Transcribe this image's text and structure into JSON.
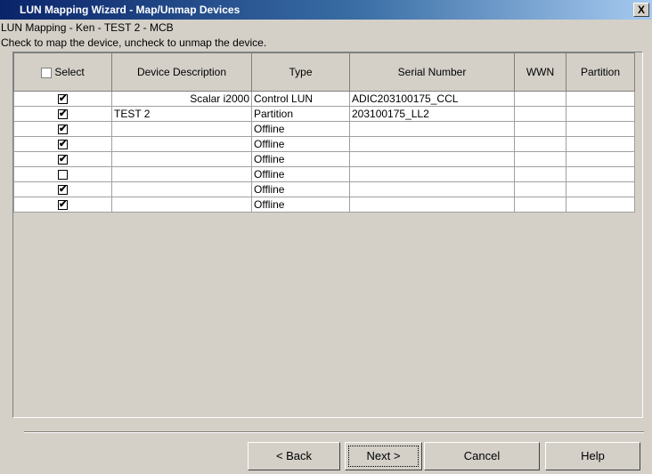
{
  "window": {
    "title": "LUN Mapping Wizard - Map/Unmap Devices",
    "close_label": "X"
  },
  "info": {
    "line1": "LUN Mapping - Ken - TEST 2 - MCB",
    "line2": "Check to map the device, uncheck to unmap the device."
  },
  "table": {
    "headers": [
      "Select",
      "Device Description",
      "Type",
      "Serial Number",
      "WWN",
      "Partition"
    ],
    "rows": [
      {
        "checked": true,
        "description": "Scalar i2000",
        "type": "Control LUN",
        "serial": "ADIC203100175_CCL",
        "wwn": "",
        "partition": ""
      },
      {
        "checked": true,
        "description": "TEST 2",
        "type": "Partition",
        "serial": "203100175_LL2",
        "wwn": "",
        "partition": ""
      },
      {
        "checked": true,
        "description": "",
        "type": "Offline",
        "serial": "",
        "wwn": "",
        "partition": ""
      },
      {
        "checked": true,
        "description": "",
        "type": "Offline",
        "serial": "",
        "wwn": "",
        "partition": ""
      },
      {
        "checked": true,
        "description": "",
        "type": "Offline",
        "serial": "",
        "wwn": "",
        "partition": ""
      },
      {
        "checked": false,
        "description": "",
        "type": "Offline",
        "serial": "",
        "wwn": "",
        "partition": ""
      },
      {
        "checked": true,
        "description": "",
        "type": "Offline",
        "serial": "",
        "wwn": "",
        "partition": ""
      },
      {
        "checked": true,
        "description": "",
        "type": "Offline",
        "serial": "",
        "wwn": "",
        "partition": ""
      }
    ]
  },
  "buttons": {
    "back": "< Back",
    "next": "Next >",
    "cancel": "Cancel",
    "help": "Help"
  }
}
